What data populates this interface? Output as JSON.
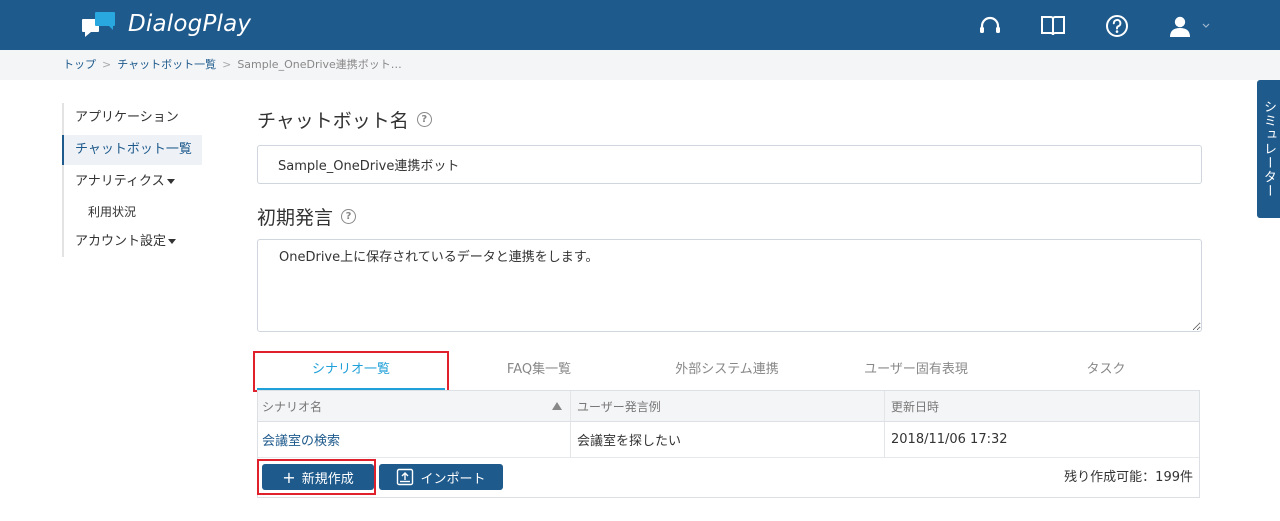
{
  "header": {
    "app_name": "DialogPlay",
    "icons": [
      "headset-icon",
      "book-icon",
      "help-icon",
      "user-icon",
      "chevron-down-icon"
    ]
  },
  "breadcrumb": {
    "items": [
      "トップ",
      "チャットボット一覧"
    ],
    "current": "Sample_OneDrive連携ボット…",
    "separator": ">"
  },
  "sidebar": {
    "items": [
      {
        "label": "アプリケーション"
      },
      {
        "label": "チャットボット一覧"
      },
      {
        "label": "アナリティクス"
      },
      {
        "label": "利用状況"
      },
      {
        "label": "アカウント設定"
      }
    ]
  },
  "simulator": {
    "label": "シミュレーター"
  },
  "form": {
    "bot_name_label": "チャットボット名",
    "bot_name_value": "Sample_OneDrive連携ボット",
    "initial_utterance_label": "初期発言",
    "initial_utterance_value": "OneDrive上に保存されているデータと連携をします。",
    "help_glyph": "?"
  },
  "tabs": [
    {
      "label": "シナリオ一覧"
    },
    {
      "label": "FAQ集一覧"
    },
    {
      "label": "外部システム連携"
    },
    {
      "label": "ユーザー固有表現"
    },
    {
      "label": "タスク"
    }
  ],
  "table": {
    "headers": [
      "シナリオ名",
      "ユーザー発言例",
      "更新日時"
    ],
    "rows": [
      {
        "name": "会議室の検索",
        "example": "会議室を探したい",
        "updated": "2018/11/06 17:32"
      }
    ]
  },
  "actions": {
    "new_label": "新規作成",
    "new_glyph": "+",
    "import_label": "インポート",
    "remaining": "残り作成可能：199件"
  },
  "colors": {
    "header_bg": "#1e5a8c",
    "accent": "#1fa0d8",
    "highlight": "#e0202a"
  }
}
